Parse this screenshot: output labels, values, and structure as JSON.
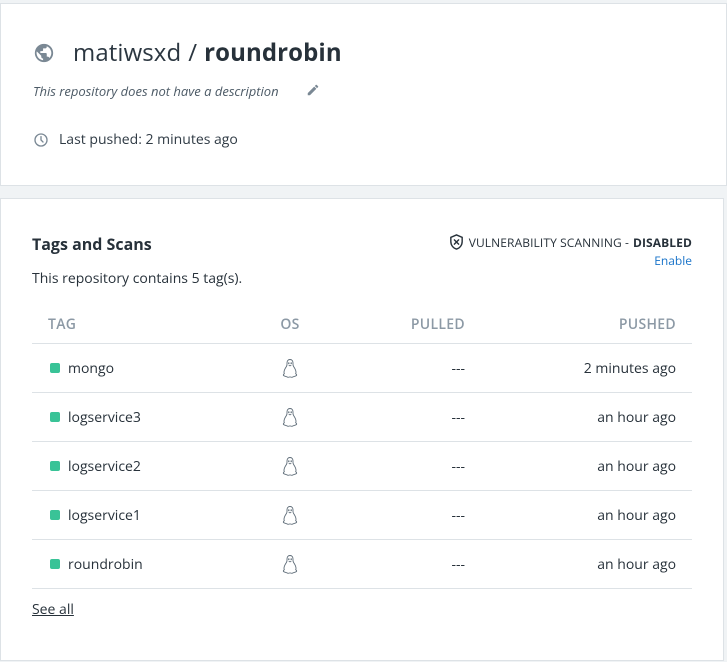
{
  "repo": {
    "namespace": "matiwsxd",
    "separator": "/",
    "name": "roundrobin",
    "description": "This repository does not have a description",
    "last_pushed": "Last pushed: 2 minutes ago"
  },
  "tags": {
    "title": "Tags and Scans",
    "contains": "This repository contains 5 tag(s).",
    "scan_label": "VULNERABILITY SCANNING -",
    "scan_status": "DISABLED",
    "enable_link": "Enable",
    "columns": {
      "tag": "TAG",
      "os": "OS",
      "pulled": "PULLED",
      "pushed": "PUSHED"
    },
    "rows": [
      {
        "tag": "mongo",
        "os": "linux-icon",
        "pulled": "---",
        "pushed": "2 minutes ago"
      },
      {
        "tag": "logservice3",
        "os": "linux-icon",
        "pulled": "---",
        "pushed": "an hour ago"
      },
      {
        "tag": "logservice2",
        "os": "linux-icon",
        "pulled": "---",
        "pushed": "an hour ago"
      },
      {
        "tag": "logservice1",
        "os": "linux-icon",
        "pulled": "---",
        "pushed": "an hour ago"
      },
      {
        "tag": "roundrobin",
        "os": "linux-icon",
        "pulled": "---",
        "pushed": "an hour ago"
      }
    ],
    "see_all": "See all"
  },
  "colors": {
    "tag_dot": "#39c397",
    "link": "#1873c9",
    "header_text": "#8c99a5"
  }
}
